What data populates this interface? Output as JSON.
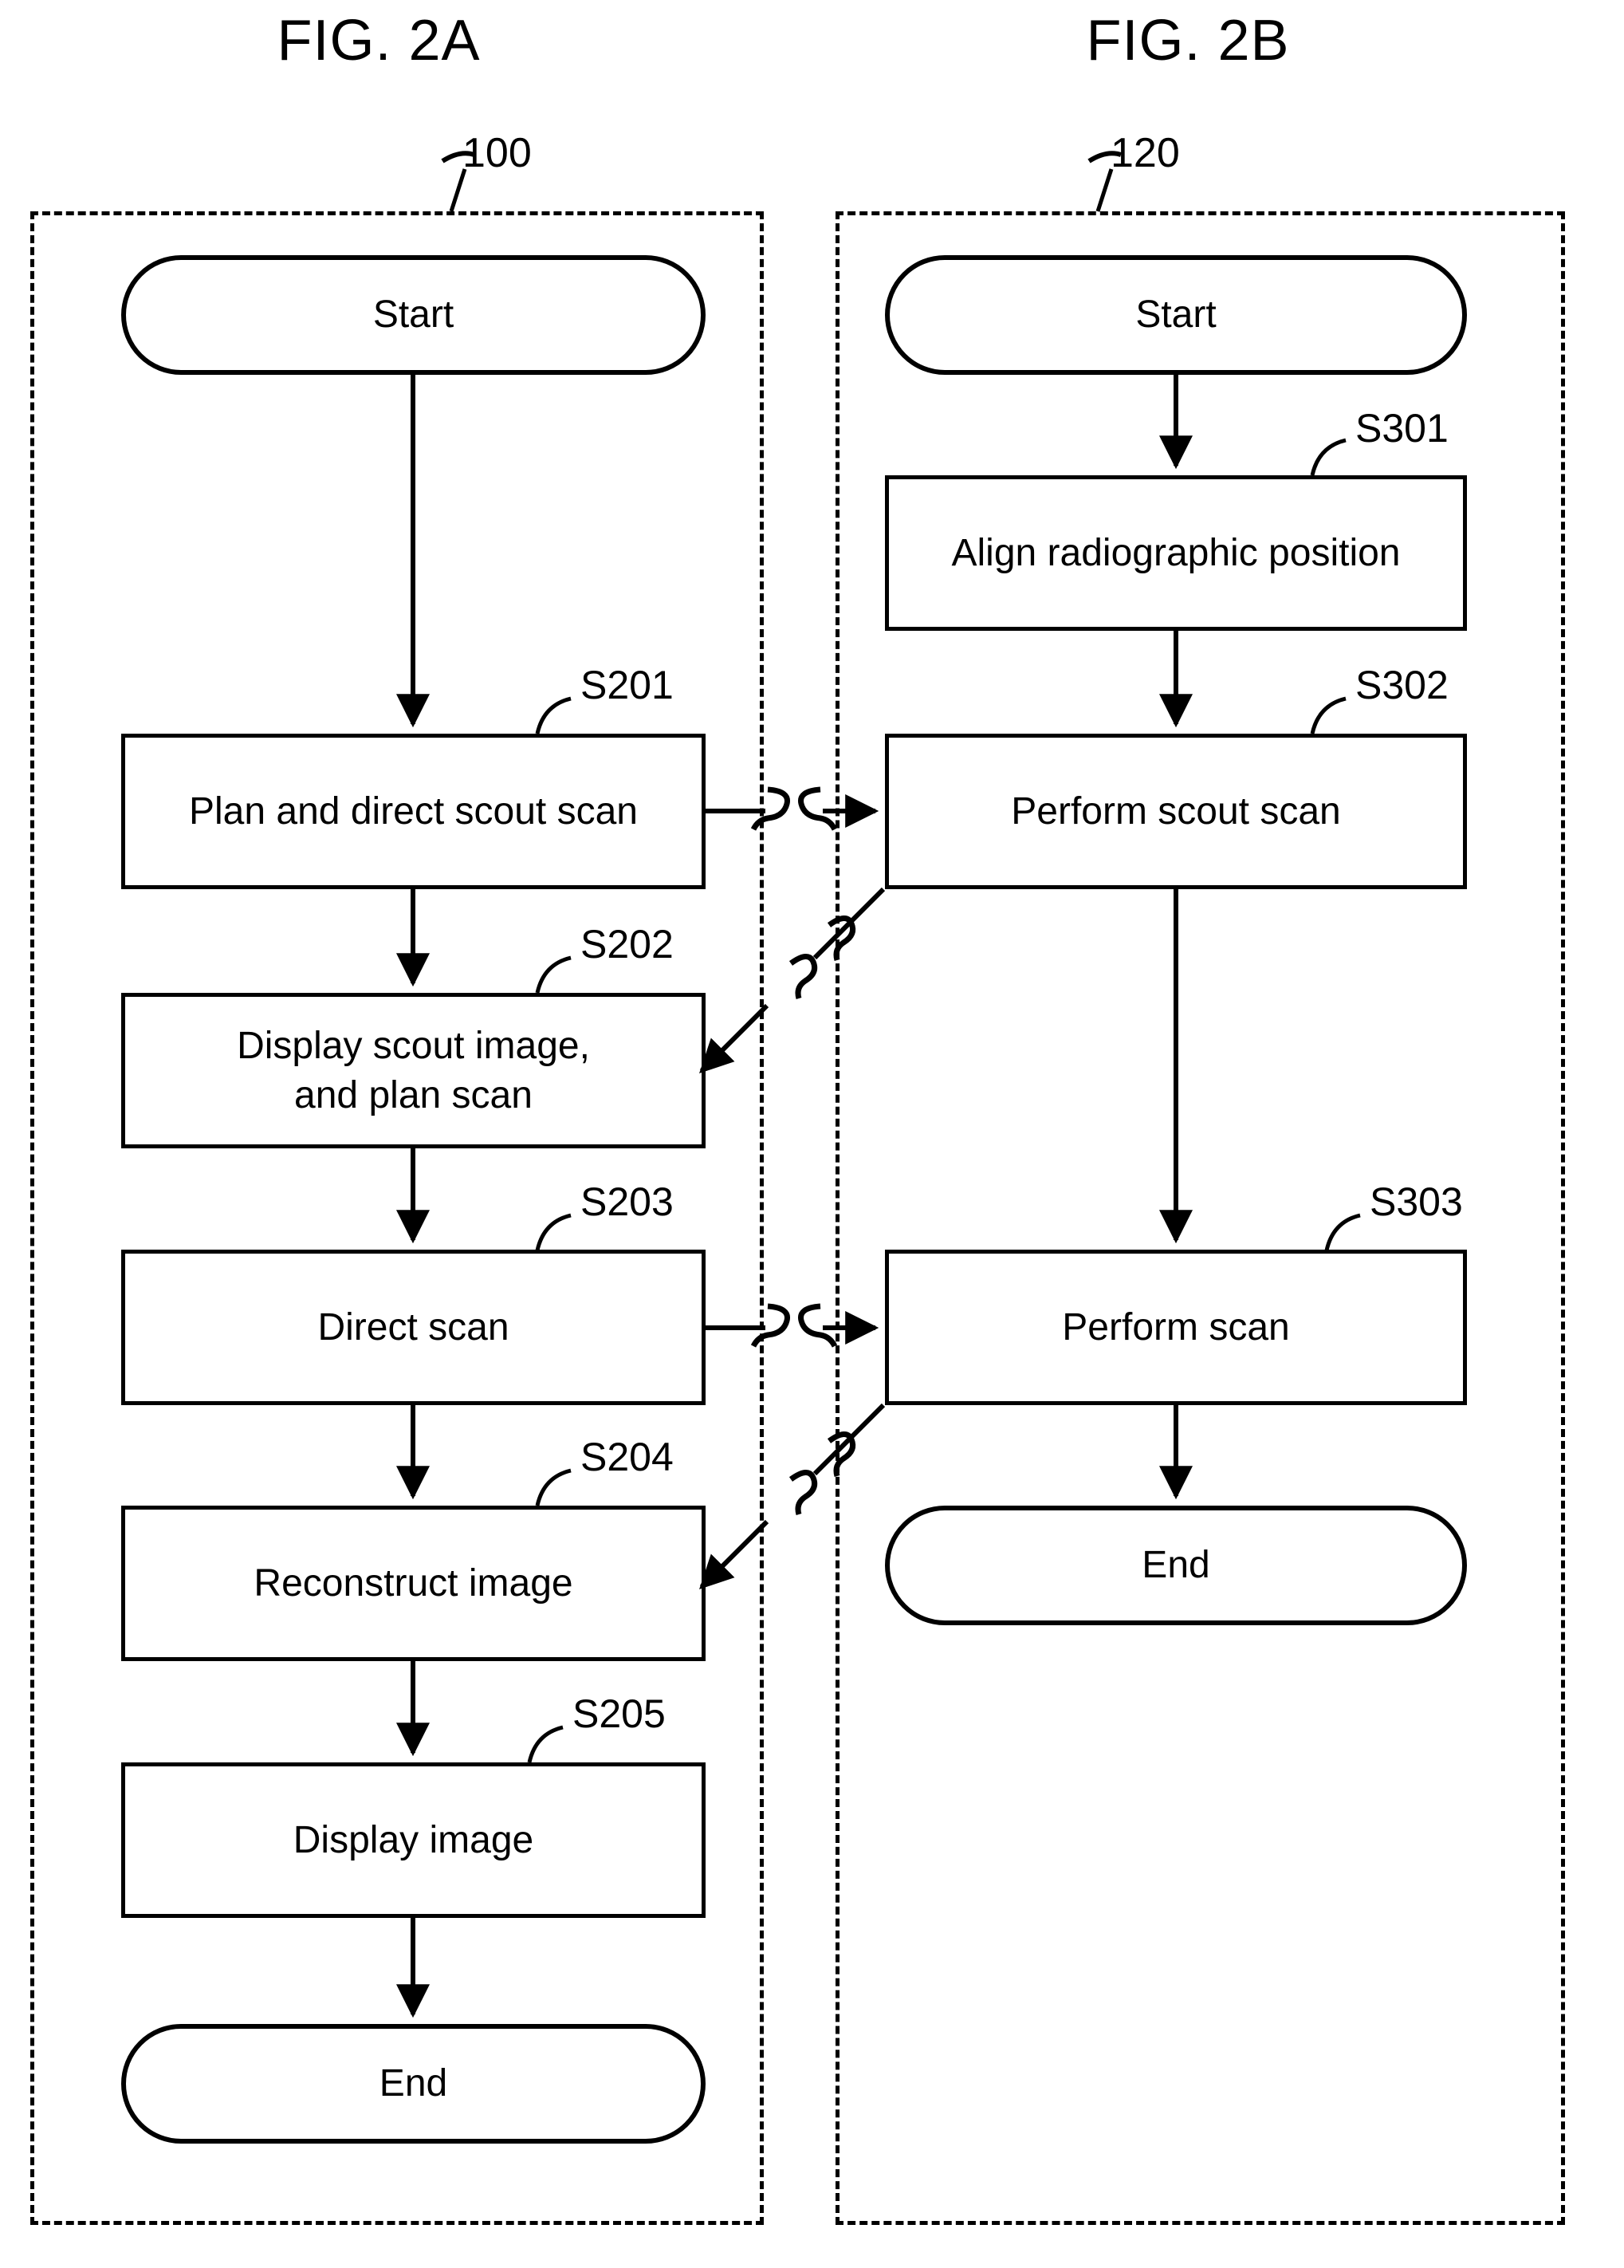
{
  "figures": [
    {
      "title": "FIG. 2A",
      "ref_number": "100",
      "nodes": [
        {
          "label": "Start",
          "step": ""
        },
        {
          "label": "Plan and direct scout scan",
          "step": "S201"
        },
        {
          "label": "Display scout image,\nand plan scan",
          "step": "S202"
        },
        {
          "label": "Direct scan",
          "step": "S203"
        },
        {
          "label": "Reconstruct image",
          "step": "S204"
        },
        {
          "label": "Display image",
          "step": "S205"
        },
        {
          "label": "End",
          "step": ""
        }
      ]
    },
    {
      "title": "FIG. 2B",
      "ref_number": "120",
      "nodes": [
        {
          "label": "Start",
          "step": ""
        },
        {
          "label": "Align radiographic position",
          "step": "S301"
        },
        {
          "label": "Perform scout scan",
          "step": "S302"
        },
        {
          "label": "Perform scan",
          "step": "S303"
        },
        {
          "label": "End",
          "step": ""
        }
      ]
    }
  ],
  "fig2a": {
    "title": "FIG. 2A",
    "ref_number": "100",
    "start_label": "Start",
    "s201_label": "Plan and direct scout scan",
    "s201_step": "S201",
    "s202_label": "Display scout image,\nand plan scan",
    "s202_step": "S202",
    "s203_label": "Direct scan",
    "s203_step": "S203",
    "s204_label": "Reconstruct image",
    "s204_step": "S204",
    "s205_label": "Display image",
    "s205_step": "S205",
    "end_label": "End"
  },
  "fig2b": {
    "title": "FIG. 2B",
    "ref_number": "120",
    "start_label": "Start",
    "s301_label": "Align radiographic position",
    "s301_step": "S301",
    "s302_label": "Perform scout scan",
    "s302_step": "S302",
    "s303_label": "Perform scan",
    "s303_step": "S303",
    "end_label": "End"
  },
  "connectors": {
    "cross_links": [
      {
        "from": "S201",
        "to": "S302",
        "style": "broken-horizontal-arrow"
      },
      {
        "from": "S302",
        "to": "S202",
        "style": "broken-diagonal-arrow"
      },
      {
        "from": "S203",
        "to": "S303",
        "style": "broken-horizontal-arrow"
      },
      {
        "from": "S303",
        "to": "S204",
        "style": "broken-diagonal-arrow"
      }
    ],
    "break_symbol": "S-squiggle"
  },
  "colors": {
    "line": "#000000",
    "background": "#ffffff"
  }
}
